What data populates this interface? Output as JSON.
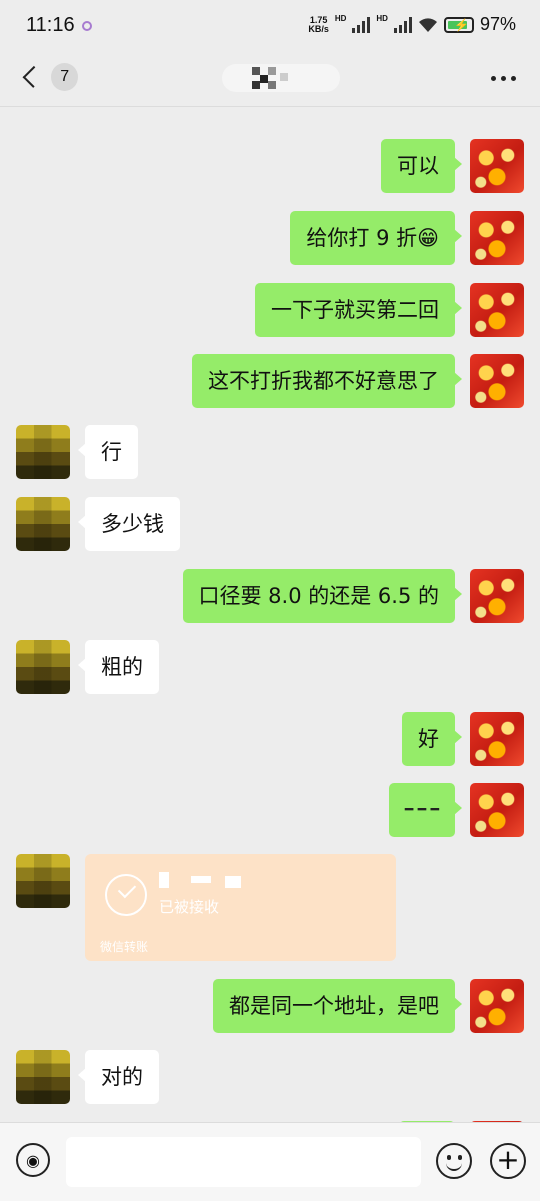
{
  "status": {
    "time": "11:16",
    "net_speed_value": "1.75",
    "net_speed_unit": "KB/s",
    "signal1_label": "HD",
    "signal2_label": "HD",
    "battery": "97%"
  },
  "header": {
    "unread_count": "7"
  },
  "messages": [
    {
      "side": "out",
      "text": "可以"
    },
    {
      "side": "out",
      "text": "给你打 9 折😁"
    },
    {
      "side": "out",
      "text": "一下子就买第二回"
    },
    {
      "side": "out",
      "text": "这不打折我都不好意思了"
    },
    {
      "side": "in",
      "text": "行"
    },
    {
      "side": "in",
      "text": "多少钱"
    },
    {
      "side": "out",
      "text": "口径要 8.0 的还是 6.5 的"
    },
    {
      "side": "in",
      "text": "粗的"
    },
    {
      "side": "out",
      "text": "好"
    },
    {
      "side": "out",
      "text": "━ ━ ━"
    },
    {
      "side": "in",
      "type": "transfer"
    },
    {
      "side": "out",
      "text": "都是同一个地址，是吧"
    },
    {
      "side": "in",
      "text": "对的"
    }
  ],
  "transfer": {
    "status": "已被接收",
    "footer": "微信转账"
  },
  "input": {
    "placeholder": ""
  },
  "colors": {
    "out_bubble": "#95ec69",
    "in_bubble": "#ffffff",
    "transfer_card": "#fde2c7",
    "background": "#ededed"
  }
}
